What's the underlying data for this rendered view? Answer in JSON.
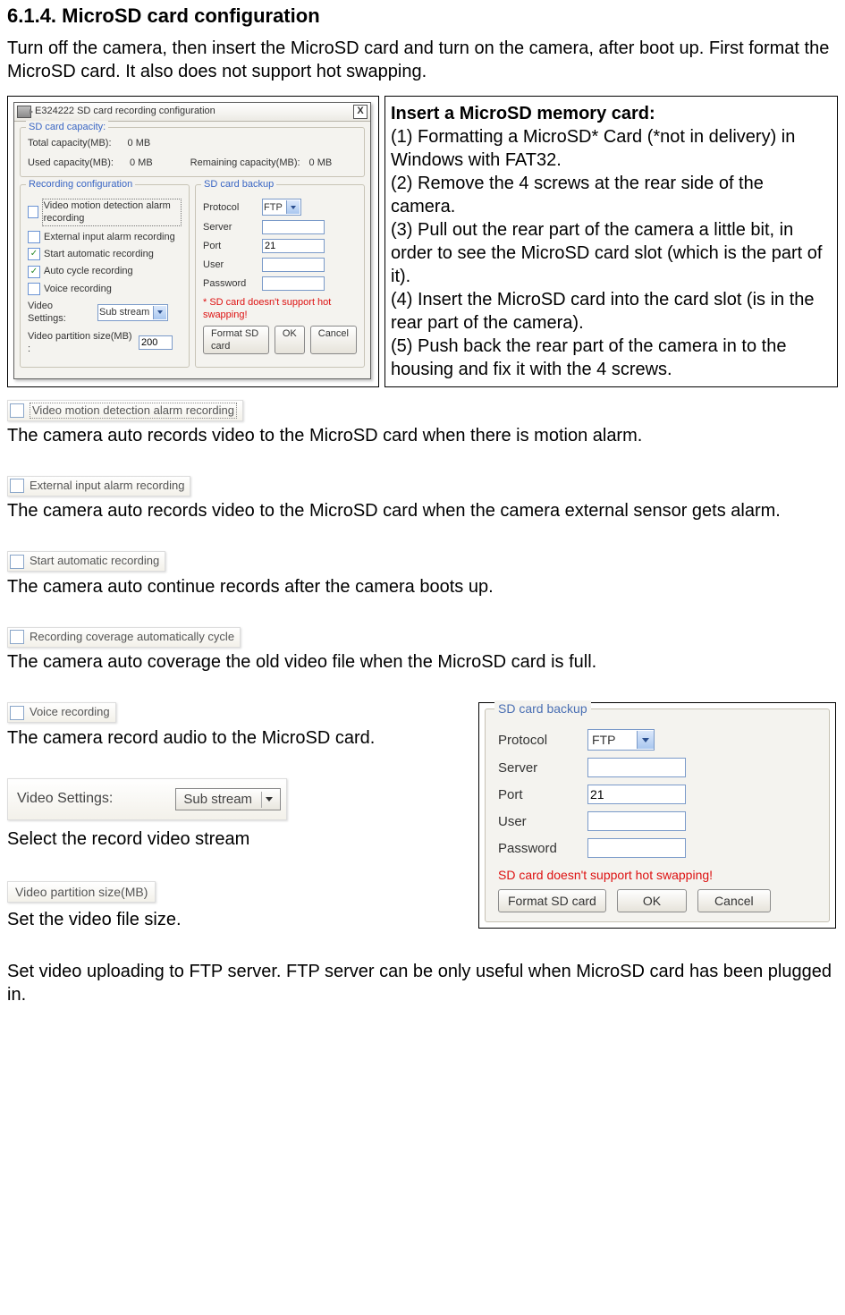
{
  "heading": "6.1.4.    MicroSD card configuration",
  "intro": "Turn off the camera, then insert the MicroSD card and turn on the camera, after boot up. First format the MicroSD card. It also does not support hot swapping.",
  "dialog": {
    "title": "E324222 SD card recording configuration",
    "close": "X",
    "capacity": {
      "group": "SD card capacity:",
      "total_label": "Total capacity(MB):",
      "total_value": "0 MB",
      "used_label": "Used capacity(MB):",
      "used_value": "0 MB",
      "remain_label": "Remaining capacity(MB):",
      "remain_value": "0 MB"
    },
    "recording": {
      "group": "Recording configuration",
      "opt1": "Video motion detection alarm recording",
      "opt2": "External input alarm recording",
      "opt3": "Start automatic recording",
      "opt4": "Auto cycle recording",
      "opt5": "Voice recording",
      "video_settings_label": "Video Settings:",
      "video_settings_value": "Sub stream",
      "partition_label": "Video partition size(MB) :",
      "partition_value": "200"
    },
    "backup": {
      "group": "SD card backup",
      "protocol_label": "Protocol",
      "protocol_value": "FTP",
      "server_label": "Server",
      "port_label": "Port",
      "port_value": "21",
      "user_label": "User",
      "password_label": "Password",
      "warning": "* SD card doesn't support hot swapping!",
      "format_btn": "Format SD card",
      "ok_btn": "OK",
      "cancel_btn": "Cancel"
    }
  },
  "instructions": {
    "title": "Insert a MicroSD memory card:",
    "s1": "(1) Formatting a MicroSD* Card (*not in delivery) in Windows with FAT32.",
    "s2": "(2) Remove the 4 screws at the rear side of the camera.",
    "s3": "(3) Pull out the rear part of the camera a little bit, in order to see the MicroSD card slot (which is the part of it).",
    "s4": "(4) Insert the MicroSD card into the card slot (is in the rear part of the camera).",
    "s5": "(5) Push back the rear part of the camera in to the housing and fix it with the 4 screws."
  },
  "snips": {
    "s1": "Video motion detection alarm recording",
    "d1": "The camera auto records video to the MicroSD card when there is motion alarm.",
    "s2": "External input alarm recording",
    "d2": "The camera auto records video to the MicroSD card when the camera external sensor gets alarm.",
    "s3": "Start automatic recording",
    "d3": "The camera auto continue records after the camera boots up.",
    "s4": "Recording coverage automatically cycle",
    "d4": "The camera auto coverage the old video file when the MicroSD card is full.",
    "s5": "Voice recording",
    "d5": "The camera record audio to the MicroSD card.",
    "vs_label": "Video Settings:",
    "vs_value": "Sub stream",
    "d6": "Select the record video stream",
    "vps_label": "Video partition size(MB)",
    "d7": "Set the video file size."
  },
  "panel": {
    "group": "SD card backup",
    "protocol_label": "Protocol",
    "protocol_value": "FTP",
    "server_label": "Server",
    "port_label": "Port",
    "port_value": "21",
    "user_label": "User",
    "password_label": "Password",
    "warning": "SD card doesn't support hot swapping!",
    "format_btn": "Format SD card",
    "ok_btn": "OK",
    "cancel_btn": "Cancel"
  },
  "footer": "Set video uploading to FTP server. FTP server can be only useful when MicroSD card has been plugged in."
}
